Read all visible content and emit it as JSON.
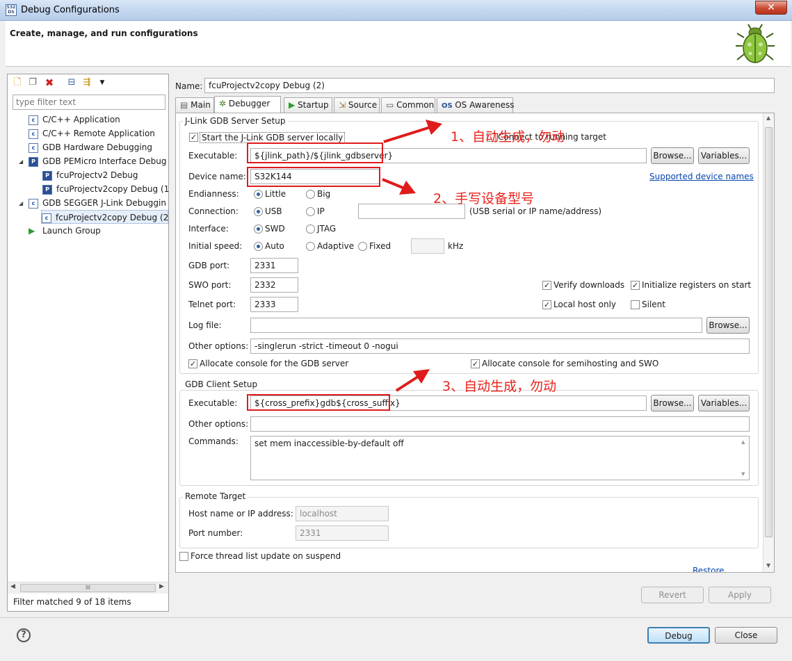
{
  "window": {
    "title": "Debug Configurations",
    "close_glyph": "✕",
    "app_icon": "S32 DS"
  },
  "header": {
    "title": "Create, manage, and run configurations"
  },
  "left": {
    "toolbar_icons": [
      "new-config-icon",
      "duplicate-icon",
      "delete-icon",
      "collapse-all-icon",
      "filter-icon",
      "view-menu-icon"
    ],
    "filter_placeholder": "type filter text",
    "tree": [
      {
        "label": "C/C++ Application",
        "level": 0,
        "icon": "c"
      },
      {
        "label": "C/C++ Remote Application",
        "level": 0,
        "icon": "c"
      },
      {
        "label": "GDB Hardware Debugging",
        "level": 0,
        "icon": "c"
      },
      {
        "label": "GDB PEMicro Interface Debug",
        "level": 0,
        "icon": "pe",
        "expanded": true
      },
      {
        "label": "fcuProjectv2 Debug",
        "level": 1,
        "icon": "pe"
      },
      {
        "label": "fcuProjectv2copy Debug (1",
        "level": 1,
        "icon": "pe"
      },
      {
        "label": "GDB SEGGER J-Link Debuggin",
        "level": 0,
        "icon": "c",
        "expanded": true
      },
      {
        "label": "fcuProjectv2copy Debug (2",
        "level": 1,
        "icon": "c",
        "selected": true
      },
      {
        "label": "Launch Group",
        "level": 0,
        "icon": "launch"
      }
    ],
    "filter_status": "Filter matched 9 of 18 items",
    "scroll_thumb": "III"
  },
  "name_label": "Name:",
  "name_value": "fcuProjectv2copy Debug (2)",
  "tabs": [
    "Main",
    "Debugger",
    "Startup",
    "Source",
    "Common",
    "OS Awareness"
  ],
  "active_tab": "Debugger",
  "server": {
    "group_title": "J-Link GDB Server Setup",
    "start_locally": "Start the J-Link GDB server locally",
    "connect_running": "Connect to running target",
    "executable_label": "Executable:",
    "executable_value": "${jlink_path}/${jlink_gdbserver}",
    "browse": "Browse...",
    "variables": "Variables...",
    "device_label": "Device name:",
    "device_value": "S32K144",
    "supported_link": "Supported device names",
    "endianness_label": "Endianness:",
    "endian_little": "Little",
    "endian_big": "Big",
    "connection_label": "Connection:",
    "conn_usb": "USB",
    "conn_ip": "IP",
    "conn_hint": "(USB serial or IP name/address)",
    "interface_label": "Interface:",
    "if_swd": "SWD",
    "if_jtag": "JTAG",
    "speed_label": "Initial speed:",
    "speed_auto": "Auto",
    "speed_adaptive": "Adaptive",
    "speed_fixed": "Fixed",
    "speed_unit": "kHz",
    "gdb_port_label": "GDB port:",
    "gdb_port": "2331",
    "swo_port_label": "SWO port:",
    "swo_port": "2332",
    "telnet_port_label": "Telnet port:",
    "telnet_port": "2333",
    "verify_downloads": "Verify downloads",
    "init_registers": "Initialize registers on start",
    "local_host_only": "Local host only",
    "silent": "Silent",
    "log_label": "Log file:",
    "other_label": "Other options:",
    "other_value": "-singlerun -strict -timeout 0 -nogui",
    "alloc_console": "Allocate console for the GDB server",
    "alloc_semihosting": "Allocate console for semihosting and SWO"
  },
  "client": {
    "group_title": "GDB Client Setup",
    "executable_label": "Executable:",
    "executable_value": "${cross_prefix}gdb${cross_suffix}",
    "other_label": "Other options:",
    "commands_label": "Commands:",
    "commands_value": "set mem inaccessible-by-default off"
  },
  "remote": {
    "group_title": "Remote Target",
    "host_label": "Host name or IP address:",
    "host_value": "localhost",
    "port_label": "Port number:",
    "port_value": "2331"
  },
  "force_thread": "Force thread list update on suspend",
  "restore_defaults": "Restore defaults",
  "buttons": {
    "revert": "Revert",
    "apply": "Apply",
    "debug": "Debug",
    "close": "Close"
  },
  "annotations": {
    "a1": "1、自动生成，勿动",
    "a2": "2、手写设备型号",
    "a3": "3、自动生成，勿动"
  },
  "colors": {
    "annotation_red": "#e01b1b",
    "link_blue": "#0645ad"
  }
}
